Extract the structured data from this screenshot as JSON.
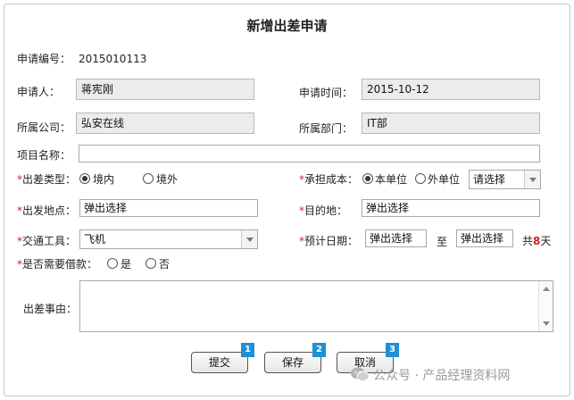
{
  "title": "新增出差申请",
  "app_no": {
    "label": "申请编号：",
    "value": "2015010113"
  },
  "applicant": {
    "label": "申请人：",
    "value": "蒋宪刚"
  },
  "apply_time": {
    "label": "申请时间：",
    "value": "2015-10-12"
  },
  "company": {
    "label": "所属公司：",
    "value": "弘安在线"
  },
  "department": {
    "label": "所属部门：",
    "value": "IT部"
  },
  "project": {
    "label": "项目名称：",
    "value": ""
  },
  "trip_type": {
    "required": "*",
    "label": "出差类型：",
    "options": [
      "境内",
      "境外"
    ],
    "selected": "境内"
  },
  "cost": {
    "required": "*",
    "label": "承担成本：",
    "options": [
      "本单位",
      "外单位"
    ],
    "selected": "本单位",
    "select_value": "请选择"
  },
  "departure": {
    "required": "*",
    "label": "出发地点：",
    "value": "弹出选择"
  },
  "destination": {
    "required": "*",
    "label": "目的地：",
    "value": "弹出选择"
  },
  "transport": {
    "required": "*",
    "label": "交通工具：",
    "value": "飞机"
  },
  "dates": {
    "required": "*",
    "label": "预计日期：",
    "start": "弹出选择",
    "to": "至",
    "end": "弹出选择",
    "total_prefix": "共",
    "days": "8",
    "total_suffix": "天"
  },
  "loan": {
    "required": "*",
    "label": "是否需要借款：",
    "options": [
      "是",
      "否"
    ],
    "selected": ""
  },
  "reason": {
    "label": "出差事由：",
    "value": ""
  },
  "buttons": [
    {
      "label": "提交",
      "badge": "1"
    },
    {
      "label": "保存",
      "badge": "2"
    },
    {
      "label": "取消",
      "badge": "3"
    }
  ],
  "watermark": "公众号 · 产品经理资料网",
  "colors": {
    "required": "#d42020",
    "badge": "#1f8fd6",
    "readonly_bg": "#ececec"
  }
}
